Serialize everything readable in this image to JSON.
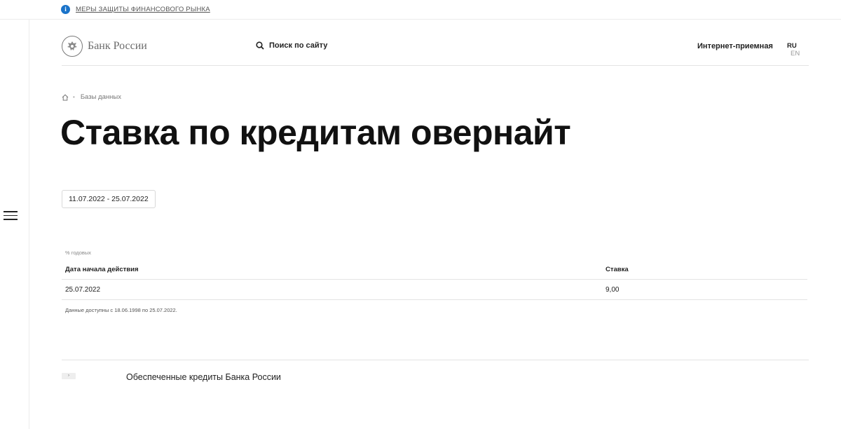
{
  "topbar": {
    "info_icon": "info-icon",
    "link_text": "МЕРЫ ЗАЩИТЫ ФИНАНСОВОГО РЫНКА"
  },
  "header": {
    "logo_text": "Банк России",
    "search_label": "Поиск по сайту",
    "reception_label": "Интернет-приемная",
    "lang_ru": "RU",
    "lang_en": "EN"
  },
  "breadcrumb": {
    "home_icon": "home-icon",
    "item": "Базы данных"
  },
  "page": {
    "title": "Ставка по кредитам овернайт",
    "date_range": "11.07.2022 - 25.07.2022"
  },
  "table": {
    "units": "% годовых",
    "columns": [
      "Дата начала действия",
      "Ставка"
    ],
    "rows": [
      [
        "25.07.2022",
        "9,00"
      ]
    ],
    "note": "Данные доступны с 18.06.1998 по 25.07.2022."
  },
  "bottom": {
    "expand_label": "›",
    "link_text": "Обеспеченные кредиты Банка России"
  },
  "colors": {
    "accent": "#1a73c9",
    "text": "#111111",
    "muted": "#777777",
    "border": "#e3e3e3"
  }
}
